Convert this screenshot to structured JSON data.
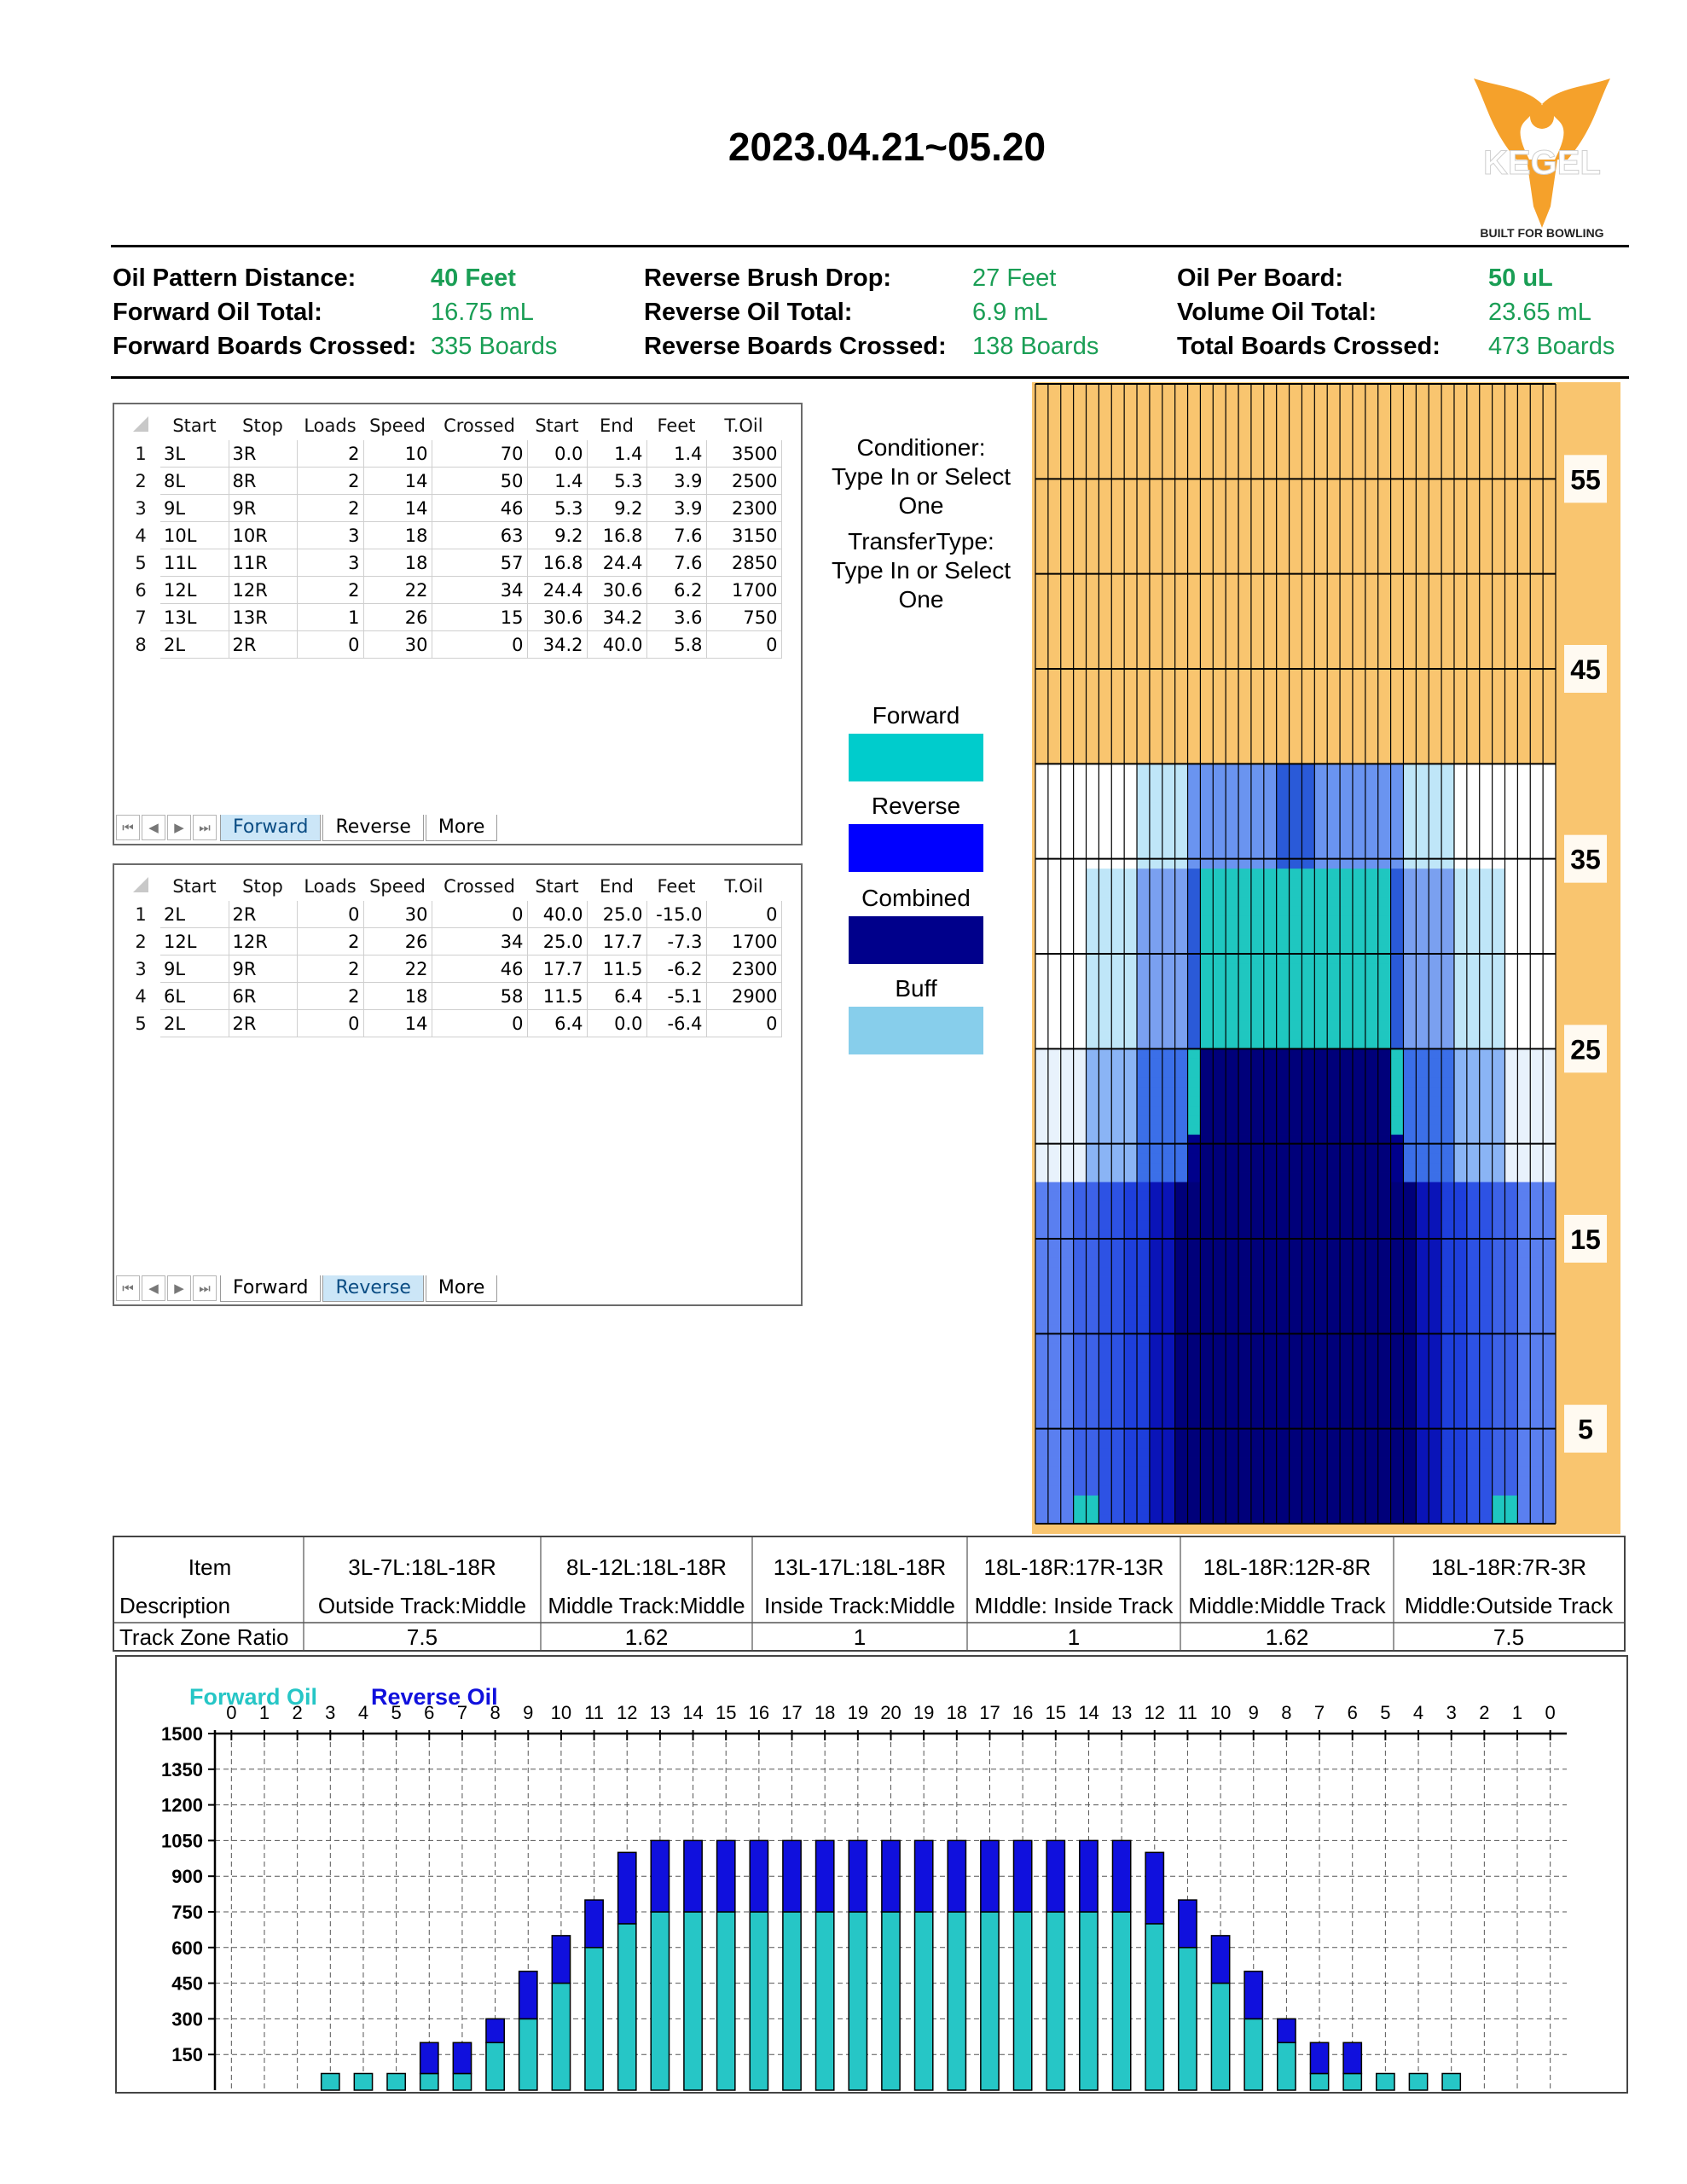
{
  "header": {
    "title": "2023.04.21~05.20",
    "logo_text": "KEGEL",
    "logo_tagline": "BUILT FOR BOWLING"
  },
  "summary": [
    {
      "label": "Oil Pattern Distance:",
      "value": "40 Feet"
    },
    {
      "label": "Forward Oil Total:",
      "value": "16.75 mL"
    },
    {
      "label": "Forward Boards Crossed:",
      "value": "335 Boards"
    },
    {
      "label": "Reverse Brush Drop:",
      "value": "27 Feet"
    },
    {
      "label": "Reverse Oil Total:",
      "value": "6.9 mL"
    },
    {
      "label": "Reverse Boards Crossed:",
      "value": "138 Boards"
    },
    {
      "label": "Oil Per Board:",
      "value": "50 uL"
    },
    {
      "label": "Volume Oil Total:",
      "value": "23.65 mL"
    },
    {
      "label": "Total Boards Crossed:",
      "value": "473 Boards"
    }
  ],
  "sheet_columns": [
    "Start",
    "Stop",
    "Loads",
    "Speed",
    "Crossed",
    "Start",
    "End",
    "Feet",
    "T.Oil"
  ],
  "forward_rows": [
    [
      "1",
      "3L",
      "3R",
      "2",
      "10",
      "70",
      "0.0",
      "1.4",
      "1.4",
      "3500"
    ],
    [
      "2",
      "8L",
      "8R",
      "2",
      "14",
      "50",
      "1.4",
      "5.3",
      "3.9",
      "2500"
    ],
    [
      "3",
      "9L",
      "9R",
      "2",
      "14",
      "46",
      "5.3",
      "9.2",
      "3.9",
      "2300"
    ],
    [
      "4",
      "10L",
      "10R",
      "3",
      "18",
      "63",
      "9.2",
      "16.8",
      "7.6",
      "3150"
    ],
    [
      "5",
      "11L",
      "11R",
      "3",
      "18",
      "57",
      "16.8",
      "24.4",
      "7.6",
      "2850"
    ],
    [
      "6",
      "12L",
      "12R",
      "2",
      "22",
      "34",
      "24.4",
      "30.6",
      "6.2",
      "1700"
    ],
    [
      "7",
      "13L",
      "13R",
      "1",
      "26",
      "15",
      "30.6",
      "34.2",
      "3.6",
      "750"
    ],
    [
      "8",
      "2L",
      "2R",
      "0",
      "30",
      "0",
      "34.2",
      "40.0",
      "5.8",
      "0"
    ]
  ],
  "reverse_rows": [
    [
      "1",
      "2L",
      "2R",
      "0",
      "30",
      "0",
      "40.0",
      "25.0",
      "-15.0",
      "0"
    ],
    [
      "2",
      "12L",
      "12R",
      "2",
      "26",
      "34",
      "25.0",
      "17.7",
      "-7.3",
      "1700"
    ],
    [
      "3",
      "9L",
      "9R",
      "2",
      "22",
      "46",
      "17.7",
      "11.5",
      "-6.2",
      "2300"
    ],
    [
      "4",
      "6L",
      "6R",
      "2",
      "18",
      "58",
      "11.5",
      "6.4",
      "-5.1",
      "2900"
    ],
    [
      "5",
      "2L",
      "2R",
      "0",
      "14",
      "0",
      "6.4",
      "0.0",
      "-6.4",
      "0"
    ]
  ],
  "sheet_tabs": [
    "Forward",
    "Reverse",
    "More"
  ],
  "middle": {
    "conditioner": [
      "Conditioner:",
      "Type In or Select",
      "One"
    ],
    "transfer": [
      "TransferType:",
      "Type In or Select",
      "One"
    ],
    "legend": [
      {
        "label": "Forward",
        "color": "#00cccc"
      },
      {
        "label": "Reverse",
        "color": "#0000ff"
      },
      {
        "label": "Combined",
        "color": "#00008b"
      },
      {
        "label": "Buff",
        "color": "#87ceeb"
      }
    ]
  },
  "heatmap": {
    "ft_labels": [
      "55",
      "45",
      "35",
      "25",
      "15",
      "5"
    ],
    "gutter_color": "#f9c56f"
  },
  "zones": {
    "row_labels": [
      "Item",
      "Description",
      "Track Zone Ratio"
    ],
    "columns": [
      {
        "item": "3L-7L:18L-18R",
        "description": "Outside Track:Middle",
        "ratio": "7.5"
      },
      {
        "item": "8L-12L:18L-18R",
        "description": "Middle Track:Middle",
        "ratio": "1.62"
      },
      {
        "item": "13L-17L:18L-18R",
        "description": "Inside Track:Middle",
        "ratio": "1"
      },
      {
        "item": "18L-18R:17R-13R",
        "description": "MIddle: Inside Track",
        "ratio": "1"
      },
      {
        "item": "18L-18R:12R-8R",
        "description": "Middle:Middle Track",
        "ratio": "1.62"
      },
      {
        "item": "18L-18R:7R-3R",
        "description": "Middle:Outside Track",
        "ratio": "7.5"
      }
    ]
  },
  "chart_data": {
    "type": "bar",
    "legend": [
      {
        "name": "Forward Oil",
        "color": "#26c6c6"
      },
      {
        "name": "Reverse Oil",
        "color": "#1010dd"
      }
    ],
    "categories": [
      "0",
      "1",
      "2",
      "3",
      "4",
      "5",
      "6",
      "7",
      "8",
      "9",
      "10",
      "11",
      "12",
      "13",
      "14",
      "15",
      "16",
      "17",
      "18",
      "19",
      "20",
      "19",
      "18",
      "17",
      "16",
      "15",
      "14",
      "13",
      "12",
      "11",
      "10",
      "9",
      "8",
      "7",
      "6",
      "5",
      "4",
      "3",
      "2",
      "1",
      "0"
    ],
    "series": [
      {
        "name": "Forward Oil",
        "values": [
          0,
          0,
          0,
          70,
          70,
          70,
          70,
          70,
          200,
          300,
          450,
          600,
          700,
          750,
          750,
          750,
          750,
          750,
          750,
          750,
          750,
          750,
          750,
          750,
          750,
          750,
          750,
          750,
          700,
          600,
          450,
          300,
          200,
          70,
          70,
          70,
          70,
          70,
          0,
          0,
          0
        ]
      },
      {
        "name": "Reverse Oil",
        "values": [
          0,
          0,
          0,
          0,
          0,
          0,
          130,
          130,
          100,
          200,
          200,
          200,
          300,
          300,
          300,
          300,
          300,
          300,
          300,
          300,
          300,
          300,
          300,
          300,
          300,
          300,
          300,
          300,
          300,
          200,
          200,
          200,
          100,
          130,
          130,
          0,
          0,
          0,
          0,
          0,
          0
        ]
      }
    ],
    "stacked": true,
    "yticks": [
      150,
      300,
      450,
      600,
      750,
      900,
      1050,
      1200,
      1350,
      1500
    ],
    "ylim": [
      0,
      1500
    ],
    "grid": true
  }
}
